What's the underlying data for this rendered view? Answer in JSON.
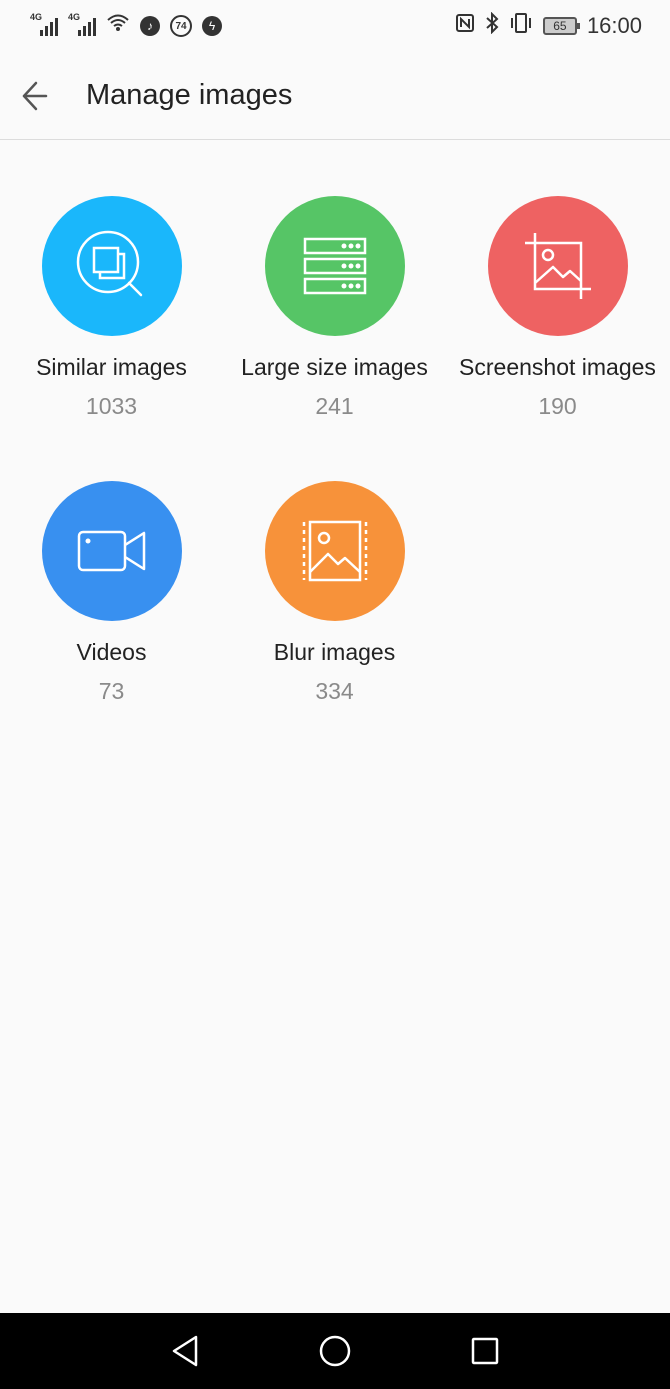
{
  "status": {
    "time": "16:00",
    "battery": "65",
    "signal1": "4G",
    "signal2": "4G",
    "badge": "74"
  },
  "header": {
    "title": "Manage images"
  },
  "tiles": [
    {
      "label": "Similar images",
      "count": "1033",
      "color": "#1ab7fb",
      "icon": "similar-search-icon"
    },
    {
      "label": "Large size images",
      "count": "241",
      "color": "#56c566",
      "icon": "storage-stack-icon"
    },
    {
      "label": "Screenshot images",
      "count": "190",
      "color": "#ee6262",
      "icon": "crop-image-icon"
    },
    {
      "label": "Videos",
      "count": "73",
      "color": "#3890f0",
      "icon": "video-camera-icon"
    },
    {
      "label": "Blur images",
      "count": "334",
      "color": "#f7923a",
      "icon": "blur-image-icon"
    }
  ]
}
